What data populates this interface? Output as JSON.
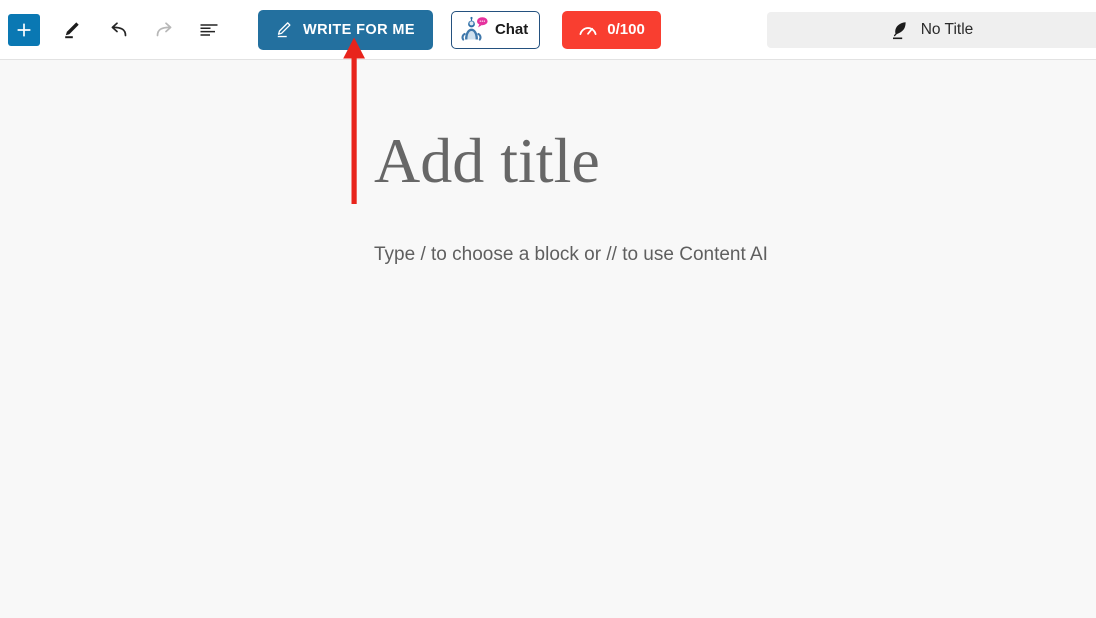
{
  "toolbar": {
    "add_block_label": "+",
    "icons": {
      "add": "plus-icon",
      "pen": "pen-highlight-icon",
      "undo": "undo-arrow-icon",
      "redo": "redo-arrow-icon",
      "list": "align-list-icon"
    },
    "write_for_me": {
      "label": "WRITE FOR ME",
      "icon": "quill-pen-icon",
      "bg_color": "#23709f",
      "text_color": "#ffffff"
    },
    "chat": {
      "label": "Chat",
      "icon": "ai-robot-avatar-icon",
      "badge_icon": "speech-bubble-icon",
      "border_color": "#24517f"
    },
    "score": {
      "label": "0/100",
      "icon": "gauge-meter-icon",
      "bg_color": "#f93e30",
      "text_color": "#ffffff"
    },
    "document_title": {
      "value": "No Title",
      "icon": "feather-quill-icon",
      "bg_color": "#efefef"
    }
  },
  "editor": {
    "title_placeholder": "Add title",
    "body_placeholder": "Type / to choose a block or // to use Content AI",
    "background_color": "#f8f8f8"
  },
  "annotation": {
    "arrow_color": "#e8241c",
    "points_to": "WRITE FOR ME"
  }
}
